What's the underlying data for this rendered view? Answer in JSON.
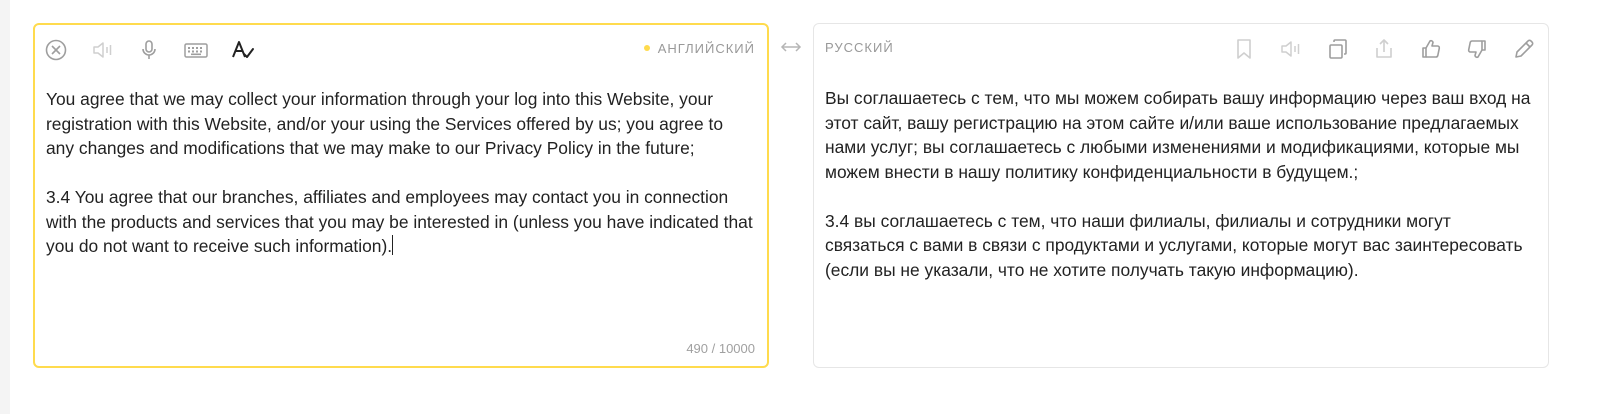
{
  "source": {
    "language_label": "английский",
    "text_paragraph_1": "You agree that we may collect your information through your log into this Website, your registration with this Website, and/or your using the Services offered by us; you agree to any changes and modifications that we may make to our Privacy Policy in the future;",
    "text_paragraph_2": "3.4 You agree that our branches, affiliates and employees may contact you in connection with the products and services that you may be interested in (unless you have indicated that you do not want to receive such information).",
    "char_count": "490 / 10000",
    "toolbar_icons": [
      "clear-icon",
      "speaker-icon",
      "microphone-icon",
      "keyboard-icon",
      "spellcheck-icon"
    ]
  },
  "target": {
    "language_label": "русский",
    "text_paragraph_1": "Вы соглашаетесь с тем, что мы можем собирать вашу информацию через ваш вход на этот сайт, вашу регистрацию на этом сайте и/или ваше использование предлагаемых нами услуг; вы соглашаетесь с любыми изменениями и модификациями, которые мы можем внести в нашу политику конфиденциальности в будущем.;",
    "text_paragraph_2": "3.4 вы соглашаетесь с тем, что наши филиалы, филиалы и сотрудники могут связаться с вами в связи с продуктами и услугами, которые могут вас заинтересовать (если вы не указали, что не хотите получать такую информацию).",
    "toolbar_icons": [
      "bookmark-icon",
      "speaker-icon",
      "copy-icon",
      "share-icon",
      "thumbs-up-icon",
      "thumbs-down-icon",
      "edit-icon"
    ]
  },
  "swap_icon": "swap-icon",
  "colors": {
    "accent_yellow": "#ffdb4d",
    "icon_gray": "#9e9e9e",
    "icon_dark": "#222222",
    "muted_text": "#999999"
  }
}
